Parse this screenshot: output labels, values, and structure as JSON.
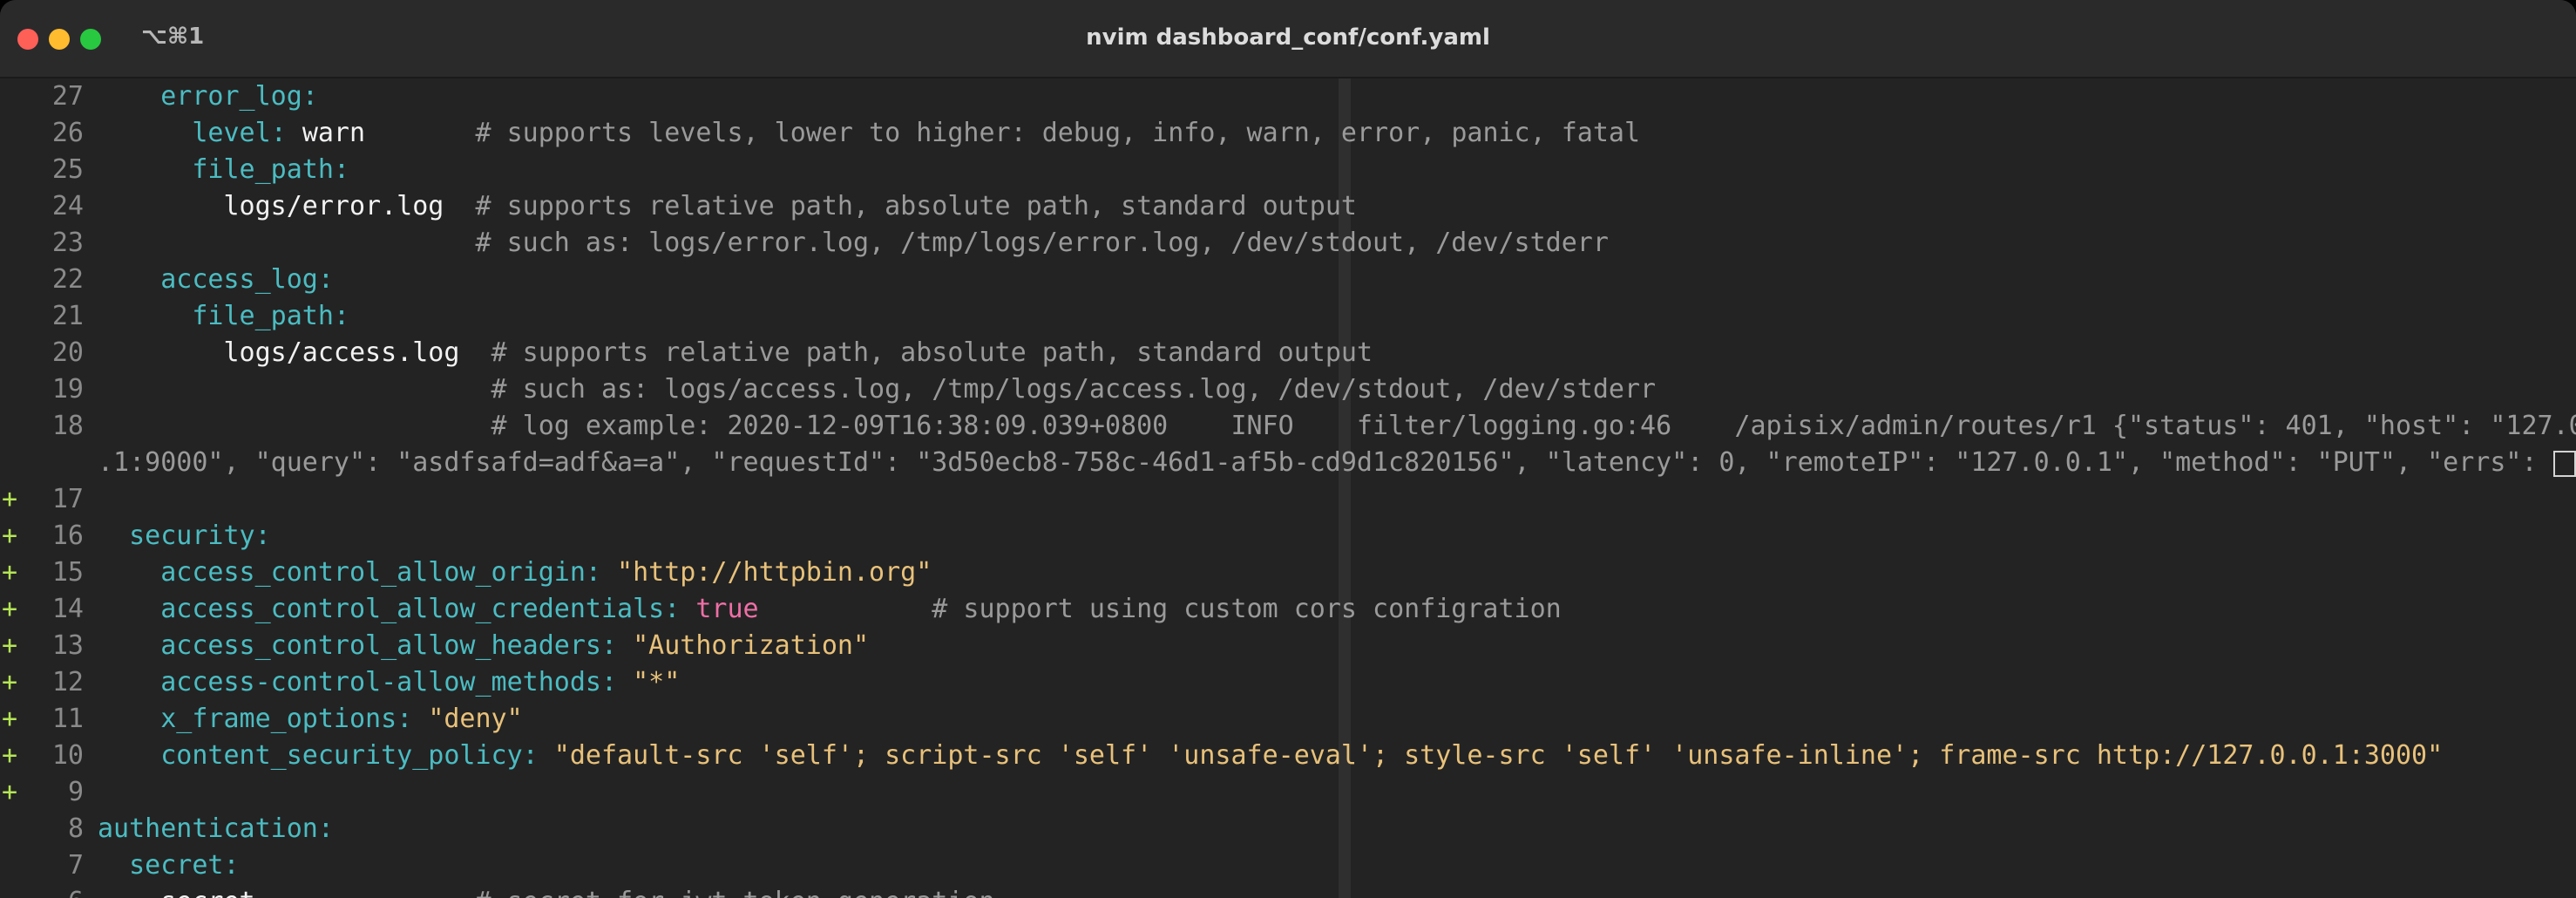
{
  "window": {
    "title": "nvim dashboard_conf/conf.yaml",
    "shortcut": "⌥⌘1"
  },
  "editor": {
    "lines": [
      {
        "num": "27",
        "sign": "",
        "segments": [
          {
            "t": "    ",
            "c": "p"
          },
          {
            "t": "error_log",
            "c": "k"
          },
          {
            "t": ":",
            "c": "k"
          }
        ]
      },
      {
        "num": "26",
        "sign": "",
        "segments": [
          {
            "t": "      ",
            "c": "p"
          },
          {
            "t": "level",
            "c": "k"
          },
          {
            "t": ": ",
            "c": "k"
          },
          {
            "t": "warn",
            "c": "w"
          },
          {
            "t": "       ",
            "c": "p"
          },
          {
            "t": "# supports levels, lower to higher: debug, info, warn, error, panic, fatal",
            "c": "c"
          }
        ]
      },
      {
        "num": "25",
        "sign": "",
        "segments": [
          {
            "t": "      ",
            "c": "p"
          },
          {
            "t": "file_path",
            "c": "k"
          },
          {
            "t": ":",
            "c": "k"
          }
        ]
      },
      {
        "num": "24",
        "sign": "",
        "segments": [
          {
            "t": "        ",
            "c": "p"
          },
          {
            "t": "logs/error.log",
            "c": "w"
          },
          {
            "t": "  ",
            "c": "p"
          },
          {
            "t": "# supports relative path, absolute path, standard output",
            "c": "c"
          }
        ]
      },
      {
        "num": "23",
        "sign": "",
        "segments": [
          {
            "t": "                        ",
            "c": "p"
          },
          {
            "t": "# such as: logs/error.log, /tmp/logs/error.log, /dev/stdout, /dev/stderr",
            "c": "c"
          }
        ]
      },
      {
        "num": "22",
        "sign": "",
        "segments": [
          {
            "t": "    ",
            "c": "p"
          },
          {
            "t": "access_log",
            "c": "k"
          },
          {
            "t": ":",
            "c": "k"
          }
        ]
      },
      {
        "num": "21",
        "sign": "",
        "segments": [
          {
            "t": "      ",
            "c": "p"
          },
          {
            "t": "file_path",
            "c": "k"
          },
          {
            "t": ":",
            "c": "k"
          }
        ]
      },
      {
        "num": "20",
        "sign": "",
        "segments": [
          {
            "t": "        ",
            "c": "p"
          },
          {
            "t": "logs/access.log",
            "c": "w"
          },
          {
            "t": "  ",
            "c": "p"
          },
          {
            "t": "# supports relative path, absolute path, standard output",
            "c": "c"
          }
        ]
      },
      {
        "num": "19",
        "sign": "",
        "segments": [
          {
            "t": "                         ",
            "c": "p"
          },
          {
            "t": "# such as: logs/access.log, /tmp/logs/access.log, /dev/stdout, /dev/stderr",
            "c": "c"
          }
        ]
      },
      {
        "num": "18",
        "sign": "",
        "segments": [
          {
            "t": "                         ",
            "c": "p"
          },
          {
            "t": "# log example: 2020-12-09T16:38:09.039+0800    INFO    filter/logging.go:46    /apisix/admin/routes/r1 {\"status\": 401, \"host\": \"127.0",
            "c": "c"
          }
        ]
      },
      {
        "num": "",
        "sign": "",
        "wrap": true,
        "segments": [
          {
            "t": ".1:9000\", \"query\": \"asdfsafd=adf&a=a\", \"requestId\": \"3d50ecb8-758c-46d1-af5b-cd9d1c820156\", \"latency\": 0, \"remoteIP\": \"127.0.0.1\", \"method\": \"PUT\", \"errs\": ",
            "c": "c"
          }
        ]
      },
      {
        "num": "17",
        "sign": "+",
        "segments": []
      },
      {
        "num": "16",
        "sign": "+",
        "segments": [
          {
            "t": "  ",
            "c": "p"
          },
          {
            "t": "security",
            "c": "k"
          },
          {
            "t": ":",
            "c": "k"
          }
        ]
      },
      {
        "num": "15",
        "sign": "+",
        "segments": [
          {
            "t": "    ",
            "c": "p"
          },
          {
            "t": "access_control_allow_origin",
            "c": "k"
          },
          {
            "t": ": ",
            "c": "k"
          },
          {
            "t": "\"http://httpbin.org\"",
            "c": "s"
          }
        ]
      },
      {
        "num": "14",
        "sign": "+",
        "segments": [
          {
            "t": "    ",
            "c": "p"
          },
          {
            "t": "access_control_allow_credentials",
            "c": "k"
          },
          {
            "t": ": ",
            "c": "k"
          },
          {
            "t": "true",
            "c": "b"
          },
          {
            "t": "           ",
            "c": "p"
          },
          {
            "t": "# support using custom cors configration",
            "c": "c"
          }
        ]
      },
      {
        "num": "13",
        "sign": "+",
        "segments": [
          {
            "t": "    ",
            "c": "p"
          },
          {
            "t": "access_control_allow_headers",
            "c": "k"
          },
          {
            "t": ": ",
            "c": "k"
          },
          {
            "t": "\"Authorization\"",
            "c": "s"
          }
        ]
      },
      {
        "num": "12",
        "sign": "+",
        "segments": [
          {
            "t": "    ",
            "c": "p"
          },
          {
            "t": "access-control-allow_methods",
            "c": "k"
          },
          {
            "t": ": ",
            "c": "k"
          },
          {
            "t": "\"*\"",
            "c": "s"
          }
        ]
      },
      {
        "num": "11",
        "sign": "+",
        "segments": [
          {
            "t": "    ",
            "c": "p"
          },
          {
            "t": "x_frame_options",
            "c": "k"
          },
          {
            "t": ": ",
            "c": "k"
          },
          {
            "t": "\"deny\"",
            "c": "s"
          }
        ]
      },
      {
        "num": "10",
        "sign": "+",
        "segments": [
          {
            "t": "    ",
            "c": "p"
          },
          {
            "t": "content_security_policy",
            "c": "k"
          },
          {
            "t": ": ",
            "c": "k"
          },
          {
            "t": "\"default-src 'self'; script-src 'self' 'unsafe-eval'; style-src 'self' 'unsafe-inline'; frame-src http://127.0.0.1:3000\"",
            "c": "s"
          }
        ]
      },
      {
        "num": "9",
        "sign": "+",
        "segments": []
      },
      {
        "num": "8",
        "sign": "",
        "segments": [
          {
            "t": "authentication",
            "c": "k"
          },
          {
            "t": ":",
            "c": "k"
          }
        ]
      },
      {
        "num": "7",
        "sign": "",
        "segments": [
          {
            "t": "  ",
            "c": "p"
          },
          {
            "t": "secret",
            "c": "k"
          },
          {
            "t": ":",
            "c": "k"
          }
        ]
      },
      {
        "num": "6",
        "sign": "",
        "segments": [
          {
            "t": "    ",
            "c": "p"
          },
          {
            "t": "secret",
            "c": "w"
          },
          {
            "t": "              ",
            "c": "p"
          },
          {
            "t": "# secret for jwt token generation",
            "c": "c"
          }
        ]
      }
    ]
  },
  "colors": {
    "key": "#4bbcc2",
    "comment": "#9a9a9a",
    "string": "#e8c17a",
    "boolean": "#ee6fa5",
    "git_added_sign": "#b5e655",
    "background": "#232323"
  }
}
